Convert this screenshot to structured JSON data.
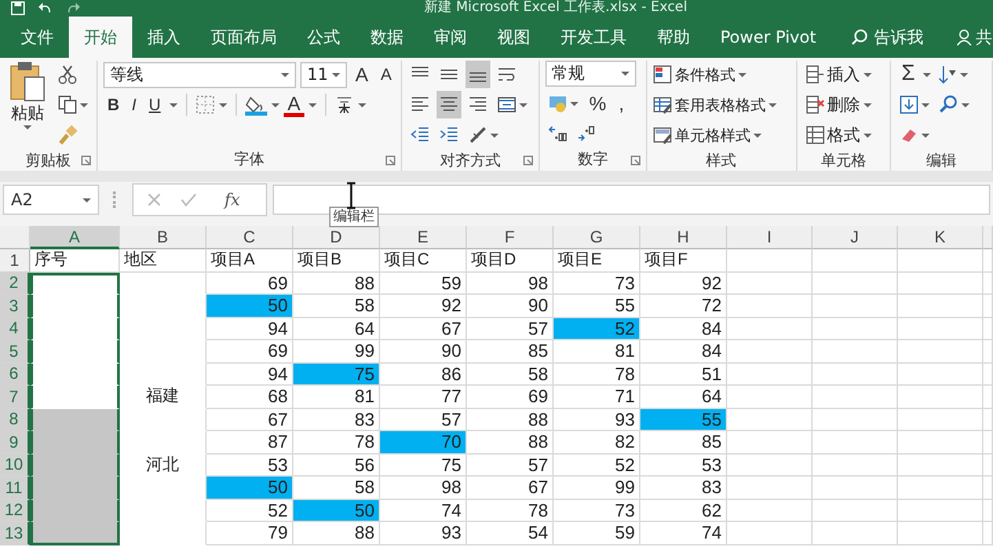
{
  "window": {
    "title": "新建 Microsoft Excel 工作表.xlsx - Excel"
  },
  "tabs": [
    {
      "label": "文件",
      "selected": false
    },
    {
      "label": "开始",
      "selected": true
    },
    {
      "label": "插入",
      "selected": false
    },
    {
      "label": "页面布局",
      "selected": false
    },
    {
      "label": "公式",
      "selected": false
    },
    {
      "label": "数据",
      "selected": false
    },
    {
      "label": "审阅",
      "selected": false
    },
    {
      "label": "视图",
      "selected": false
    },
    {
      "label": "开发工具",
      "selected": false
    },
    {
      "label": "帮助",
      "selected": false
    },
    {
      "label": "Power Pivot",
      "selected": false
    }
  ],
  "tell_me": {
    "placeholder": "告诉我"
  },
  "share": "共",
  "ribbon": {
    "clipboard": {
      "label": "剪贴板",
      "paste": "粘贴"
    },
    "font": {
      "label": "字体",
      "name": "等线",
      "size": "11",
      "size_buttons": [
        "A",
        "A"
      ],
      "style_buttons": [
        "B",
        "I",
        "U"
      ],
      "color_button": "A"
    },
    "alignment": {
      "label": "对齐方式",
      "vertical": [
        {
          "kind": "top",
          "selected": false
        },
        {
          "kind": "middle",
          "selected": false
        },
        {
          "kind": "bottom",
          "selected": true
        }
      ],
      "horizontal": [
        {
          "kind": "left",
          "selected": false
        },
        {
          "kind": "center",
          "selected": true
        },
        {
          "kind": "right",
          "selected": false
        }
      ]
    },
    "number": {
      "label": "数字",
      "format": "常规",
      "symbols": [
        "%",
        ","
      ]
    },
    "styles": {
      "label": "样式",
      "items": [
        "条件格式",
        "套用表格格式",
        "单元格样式"
      ]
    },
    "cells": {
      "label": "单元格",
      "items": [
        "插入",
        "删除",
        "格式"
      ]
    },
    "editing": {
      "label": "编辑",
      "sum": "Σ"
    }
  },
  "formula_bar": {
    "name_box": "A2",
    "function_label": "fx",
    "tooltip": "编辑栏"
  },
  "sheet": {
    "columns": [
      {
        "label": "A",
        "selected": true
      },
      {
        "label": "B",
        "selected": false
      },
      {
        "label": "C",
        "selected": false
      },
      {
        "label": "D",
        "selected": false
      },
      {
        "label": "E",
        "selected": false
      },
      {
        "label": "F",
        "selected": false
      },
      {
        "label": "G",
        "selected": false
      },
      {
        "label": "H",
        "selected": false
      },
      {
        "label": "I",
        "selected": false
      },
      {
        "label": "J",
        "selected": false
      },
      {
        "label": "K",
        "selected": false
      }
    ],
    "header_row": {
      "number": "1",
      "selected": false,
      "cells": [
        "序号",
        "地区",
        "项目A",
        "项目B",
        "项目C",
        "项目D",
        "项目E",
        "项目F"
      ]
    },
    "rows": [
      {
        "number": "2",
        "selected": true,
        "a_active": true,
        "a_selected": true,
        "scores": [
          {
            "value": "69",
            "highlighted": false
          },
          {
            "value": "88",
            "highlighted": false
          },
          {
            "value": "59",
            "highlighted": false
          },
          {
            "value": "98",
            "highlighted": false
          },
          {
            "value": "73",
            "highlighted": false
          },
          {
            "value": "92",
            "highlighted": false
          }
        ]
      },
      {
        "number": "3",
        "selected": true,
        "a_active": true,
        "a_selected": true,
        "scores": [
          {
            "value": "50",
            "highlighted": true
          },
          {
            "value": "58",
            "highlighted": false
          },
          {
            "value": "92",
            "highlighted": false
          },
          {
            "value": "90",
            "highlighted": false
          },
          {
            "value": "55",
            "highlighted": false
          },
          {
            "value": "72",
            "highlighted": false
          }
        ]
      },
      {
        "number": "4",
        "selected": true,
        "a_active": true,
        "a_selected": true,
        "scores": [
          {
            "value": "94",
            "highlighted": false
          },
          {
            "value": "64",
            "highlighted": false
          },
          {
            "value": "67",
            "highlighted": false
          },
          {
            "value": "57",
            "highlighted": false
          },
          {
            "value": "52",
            "highlighted": true
          },
          {
            "value": "84",
            "highlighted": false
          }
        ]
      },
      {
        "number": "5",
        "selected": true,
        "a_active": true,
        "a_selected": true,
        "scores": [
          {
            "value": "69",
            "highlighted": false
          },
          {
            "value": "99",
            "highlighted": false
          },
          {
            "value": "90",
            "highlighted": false
          },
          {
            "value": "85",
            "highlighted": false
          },
          {
            "value": "81",
            "highlighted": false
          },
          {
            "value": "84",
            "highlighted": false
          }
        ]
      },
      {
        "number": "6",
        "selected": true,
        "a_active": true,
        "a_selected": true,
        "scores": [
          {
            "value": "94",
            "highlighted": false
          },
          {
            "value": "75",
            "highlighted": true
          },
          {
            "value": "86",
            "highlighted": false
          },
          {
            "value": "58",
            "highlighted": false
          },
          {
            "value": "78",
            "highlighted": false
          },
          {
            "value": "51",
            "highlighted": false
          }
        ]
      },
      {
        "number": "7",
        "selected": true,
        "a_active": true,
        "a_selected": true,
        "region": "福建",
        "scores": [
          {
            "value": "68",
            "highlighted": false
          },
          {
            "value": "81",
            "highlighted": false
          },
          {
            "value": "77",
            "highlighted": false
          },
          {
            "value": "69",
            "highlighted": false
          },
          {
            "value": "71",
            "highlighted": false
          },
          {
            "value": "64",
            "highlighted": false
          }
        ]
      },
      {
        "number": "8",
        "selected": true,
        "a_active": false,
        "a_selected": true,
        "scores": [
          {
            "value": "67",
            "highlighted": false
          },
          {
            "value": "83",
            "highlighted": false
          },
          {
            "value": "57",
            "highlighted": false
          },
          {
            "value": "88",
            "highlighted": false
          },
          {
            "value": "93",
            "highlighted": false
          },
          {
            "value": "55",
            "highlighted": true
          }
        ]
      },
      {
        "number": "9",
        "selected": true,
        "a_active": false,
        "a_selected": true,
        "scores": [
          {
            "value": "87",
            "highlighted": false
          },
          {
            "value": "78",
            "highlighted": false
          },
          {
            "value": "70",
            "highlighted": true
          },
          {
            "value": "88",
            "highlighted": false
          },
          {
            "value": "82",
            "highlighted": false
          },
          {
            "value": "85",
            "highlighted": false
          }
        ]
      },
      {
        "number": "10",
        "selected": true,
        "a_active": false,
        "a_selected": true,
        "region": "河北",
        "scores": [
          {
            "value": "53",
            "highlighted": false
          },
          {
            "value": "56",
            "highlighted": false
          },
          {
            "value": "75",
            "highlighted": false
          },
          {
            "value": "57",
            "highlighted": false
          },
          {
            "value": "52",
            "highlighted": false
          },
          {
            "value": "53",
            "highlighted": false
          }
        ]
      },
      {
        "number": "11",
        "selected": true,
        "a_active": false,
        "a_selected": true,
        "scores": [
          {
            "value": "50",
            "highlighted": true
          },
          {
            "value": "58",
            "highlighted": false
          },
          {
            "value": "98",
            "highlighted": false
          },
          {
            "value": "67",
            "highlighted": false
          },
          {
            "value": "99",
            "highlighted": false
          },
          {
            "value": "83",
            "highlighted": false
          }
        ]
      },
      {
        "number": "12",
        "selected": true,
        "a_active": false,
        "a_selected": true,
        "scores": [
          {
            "value": "52",
            "highlighted": false
          },
          {
            "value": "50",
            "highlighted": true
          },
          {
            "value": "74",
            "highlighted": false
          },
          {
            "value": "78",
            "highlighted": false
          },
          {
            "value": "73",
            "highlighted": false
          },
          {
            "value": "62",
            "highlighted": false
          }
        ]
      },
      {
        "number": "13",
        "selected": true,
        "a_active": false,
        "a_selected": true,
        "scores": [
          {
            "value": "79",
            "highlighted": false
          },
          {
            "value": "88",
            "highlighted": false
          },
          {
            "value": "93",
            "highlighted": false
          },
          {
            "value": "54",
            "highlighted": false
          },
          {
            "value": "59",
            "highlighted": false
          },
          {
            "value": "74",
            "highlighted": false
          }
        ]
      }
    ]
  }
}
